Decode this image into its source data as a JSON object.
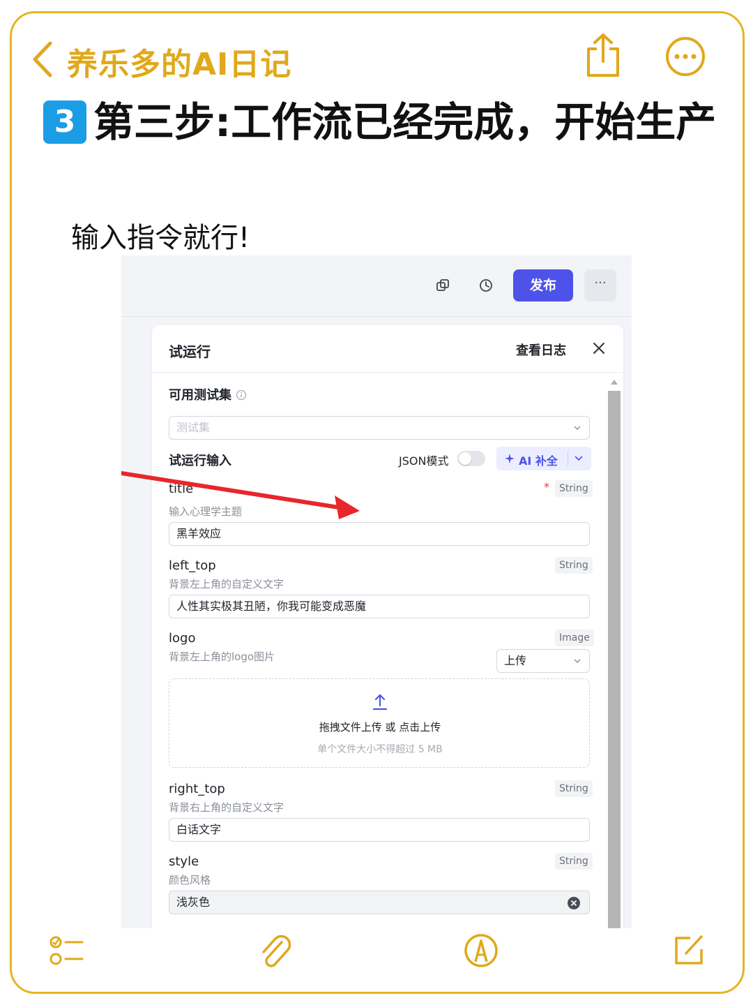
{
  "notes": {
    "back_title": "养乐多的AI日记",
    "step_number": "3",
    "heading": "第三步:工作流已经完成，开始生产",
    "subline": "输入指令就行!"
  },
  "toolbar": {
    "publish_label": "发布",
    "more_label": "···"
  },
  "panel": {
    "title": "试运行",
    "view_log": "查看日志",
    "test_set_label": "可用测试集",
    "test_set_placeholder": "测试集",
    "input_label": "试运行输入",
    "json_mode_label": "JSON模式",
    "json_mode_on": false,
    "ai_fill_label": "AI 补全"
  },
  "fields": [
    {
      "name": "title",
      "desc": "输入心理学主题",
      "type": "String",
      "required": true,
      "value": "黑羊效应"
    },
    {
      "name": "left_top",
      "desc": "背景左上角的自定义文字",
      "type": "String",
      "value": "人性其实极其丑陋，你我可能变成恶魔"
    },
    {
      "name": "logo",
      "desc": "背景左上角的logo图片",
      "type": "Image",
      "upload_mode": "上传",
      "upload_main": "拖拽文件上传 或 点击上传",
      "upload_sub": "单个文件大小不得超过 5 MB"
    },
    {
      "name": "right_top",
      "desc": "背景右上角的自定义文字",
      "type": "String",
      "value": "白话文字"
    },
    {
      "name": "style",
      "desc": "颜色风格",
      "type": "String",
      "value": "浅灰色"
    }
  ],
  "colors": {
    "notes_accent": "#e0a81b",
    "publish_bg": "#4d53e8",
    "badge_bg": "#1b9de6",
    "arrow": "#e8262b"
  }
}
